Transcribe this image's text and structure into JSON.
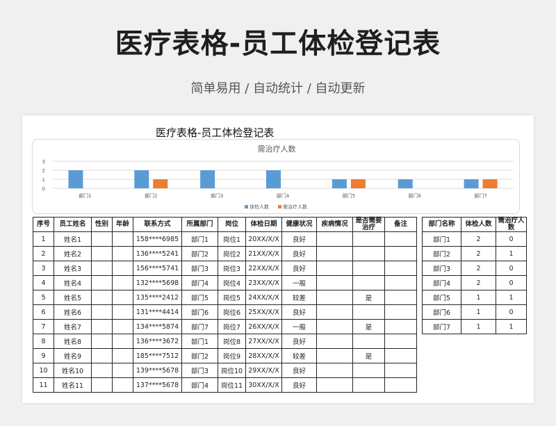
{
  "header": {
    "title": "医疗表格-员工体检登记表",
    "subtitle": "简单易用 / 自动统计 / 自动更新"
  },
  "sheet": {
    "title": "医疗表格-员工体检登记表"
  },
  "chart_data": {
    "type": "bar",
    "title": "需治疗人数",
    "categories": [
      "部门1",
      "部门2",
      "部门3",
      "部门4",
      "部门5",
      "部门6",
      "部门7"
    ],
    "series": [
      {
        "name": "体检人数",
        "values": [
          2,
          2,
          2,
          2,
          1,
          1,
          1
        ],
        "color": "#5b9bd5"
      },
      {
        "name": "需治疗人数",
        "values": [
          0,
          1,
          0,
          0,
          1,
          0,
          1
        ],
        "color": "#ed7d31"
      }
    ],
    "ylim": [
      0,
      3
    ],
    "yticks": [
      "0",
      "1",
      "2",
      "3"
    ],
    "legend": "bottom",
    "grid": true
  },
  "main_table": {
    "headers": [
      "序号",
      "员工姓名",
      "性别",
      "年龄",
      "联系方式",
      "所属部门",
      "岗位",
      "体检日期",
      "健康状况",
      "疾病情况",
      "是否需要治疗",
      "备注"
    ],
    "rows": [
      [
        "1",
        "姓名1",
        "",
        "",
        "158****6985",
        "部门1",
        "岗位1",
        "20XX/X/X",
        "良好",
        "",
        "",
        ""
      ],
      [
        "2",
        "姓名2",
        "",
        "",
        "136****5241",
        "部门2",
        "岗位2",
        "21XX/X/X",
        "良好",
        "",
        "",
        ""
      ],
      [
        "3",
        "姓名3",
        "",
        "",
        "156****5741",
        "部门3",
        "岗位3",
        "22XX/X/X",
        "良好",
        "",
        "",
        ""
      ],
      [
        "4",
        "姓名4",
        "",
        "",
        "132****5698",
        "部门4",
        "岗位4",
        "23XX/X/X",
        "一般",
        "",
        "",
        ""
      ],
      [
        "5",
        "姓名5",
        "",
        "",
        "135****2412",
        "部门5",
        "岗位5",
        "24XX/X/X",
        "较差",
        "",
        "是",
        ""
      ],
      [
        "6",
        "姓名6",
        "",
        "",
        "131****4414",
        "部门6",
        "岗位6",
        "25XX/X/X",
        "良好",
        "",
        "",
        ""
      ],
      [
        "7",
        "姓名7",
        "",
        "",
        "134****5874",
        "部门7",
        "岗位7",
        "26XX/X/X",
        "一般",
        "",
        "是",
        ""
      ],
      [
        "8",
        "姓名8",
        "",
        "",
        "136****3672",
        "部门1",
        "岗位8",
        "27XX/X/X",
        "良好",
        "",
        "",
        ""
      ],
      [
        "9",
        "姓名9",
        "",
        "",
        "185****7512",
        "部门2",
        "岗位9",
        "28XX/X/X",
        "较差",
        "",
        "是",
        ""
      ],
      [
        "10",
        "姓名10",
        "",
        "",
        "139****5678",
        "部门3",
        "岗位10",
        "29XX/X/X",
        "良好",
        "",
        "",
        ""
      ],
      [
        "11",
        "姓名11",
        "",
        "",
        "137****5678",
        "部门4",
        "岗位11",
        "30XX/X/X",
        "良好",
        "",
        "",
        ""
      ]
    ]
  },
  "side_table": {
    "headers": [
      "部门名称",
      "体检人数",
      "需治疗人数"
    ],
    "rows": [
      [
        "部门1",
        "2",
        "0"
      ],
      [
        "部门2",
        "2",
        "1"
      ],
      [
        "部门3",
        "2",
        "0"
      ],
      [
        "部门4",
        "2",
        "0"
      ],
      [
        "部门5",
        "1",
        "1"
      ],
      [
        "部门6",
        "1",
        "0"
      ],
      [
        "部门7",
        "1",
        "1"
      ]
    ]
  }
}
